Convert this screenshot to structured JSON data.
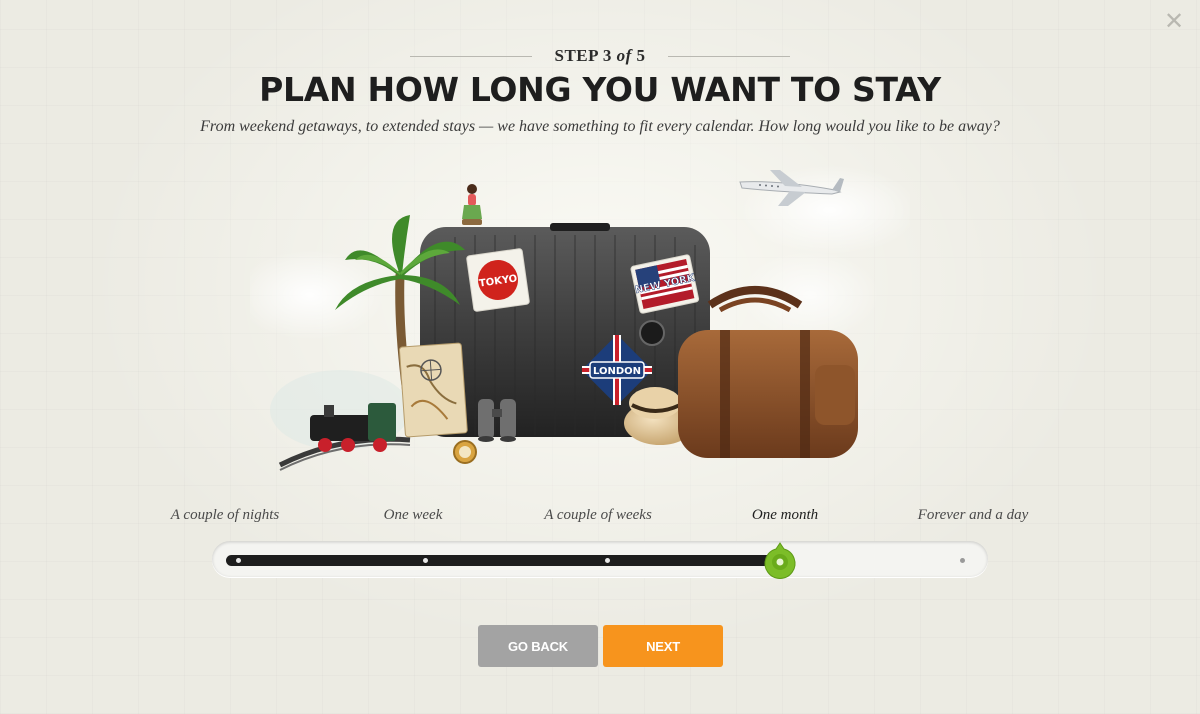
{
  "close_icon": "✕",
  "step": {
    "prefix": "STEP 3",
    "of": "of",
    "total": "5"
  },
  "title": "PLAN HOW LONG YOU WANT TO STAY",
  "subtitle": "From weekend getaways, to extended stays — we have something to fit every calendar. How long would you like to be away?",
  "illustration": {
    "stickers": [
      "TOKYO",
      "NEW YORK",
      "LONDON"
    ],
    "objects": [
      "suitcase-icon",
      "palm-tree-icon",
      "train-icon",
      "map-book-icon",
      "binoculars-icon",
      "compass-icon",
      "hat-icon",
      "duffel-bag-icon",
      "airplane-icon",
      "hula-doll-icon",
      "cloud-icon"
    ]
  },
  "slider": {
    "options": [
      "A couple of nights",
      "One week",
      "A couple of weeks",
      "One month",
      "Forever and a day"
    ],
    "selected_index": 3,
    "selected_label": "One month"
  },
  "buttons": {
    "back": "GO BACK",
    "next": "NEXT"
  },
  "colors": {
    "accent_green": "#7cbd28",
    "next_orange": "#f7941d",
    "back_gray": "#a3a3a3",
    "title": "#1e1e1e"
  }
}
